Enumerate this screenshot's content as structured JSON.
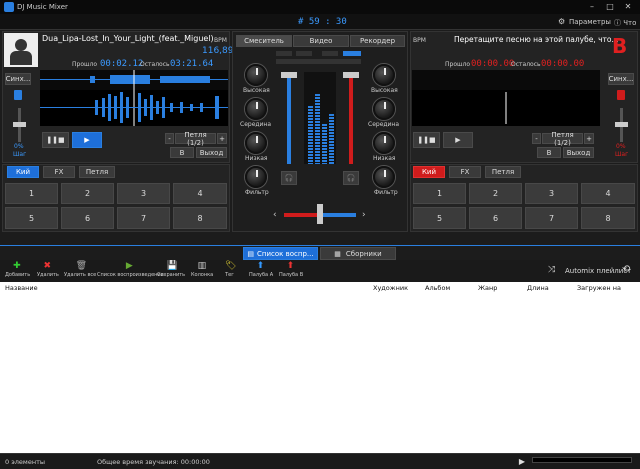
{
  "window": {
    "title": "DJ Music Mixer",
    "clock": "# 59 : 30",
    "params_label": "Параметры"
  },
  "deck_a": {
    "track_title": "Dua_Lipa-Lost_In_Your_Light_(feat._Miguel)",
    "bpm_label": "BPM",
    "bpm": "116,89",
    "elapsed_label": "Прошло",
    "elapsed": "00:02.12",
    "remaining_label": "Осталось",
    "remaining": "03:21.64",
    "sync_label": "Синх...",
    "pitch_pct": "0%",
    "step_label": "Шаг",
    "minus": "-",
    "plus": "+",
    "loop_label": "Петля (1/2)",
    "b_label": "B",
    "exit_label": "Выход",
    "tabs": [
      "Кий",
      "FX",
      "Петля"
    ],
    "pads": [
      "1",
      "2",
      "3",
      "4",
      "5",
      "6",
      "7",
      "8"
    ]
  },
  "deck_b": {
    "letter": "B",
    "bpm_label": "BPM",
    "drop_hint": "Перетащите песню на этой палубе, что...",
    "elapsed_label": "Прошло",
    "elapsed": "00:00.00",
    "remaining_label": "Осталось",
    "remaining": "00:00.00",
    "sync_label": "Синх...",
    "pitch_pct": "0%",
    "step_label": "Шаг",
    "minus": "-",
    "plus": "+",
    "loop_label": "Петля (1/2)",
    "b_label": "B",
    "exit_label": "Выход",
    "tabs": [
      "Кий",
      "FX",
      "Петля"
    ],
    "pads": [
      "1",
      "2",
      "3",
      "4",
      "5",
      "6",
      "7",
      "8"
    ]
  },
  "mixer": {
    "tabs": [
      "Смеситель",
      "Видео",
      "Рекордер"
    ],
    "knobs": [
      "Высокая",
      "Середина",
      "Низкая",
      "Фильтр"
    ]
  },
  "library": {
    "tabs": [
      "Список воспр...",
      "Сборники"
    ],
    "toolbar": [
      "Добавить",
      "Удалить",
      "Удалить все",
      "Список воспроизведения",
      "Сохранить",
      "Колонка",
      "Тег",
      "Палуба A",
      "Палуба B"
    ],
    "automix_label": "Automix плейлист",
    "columns": [
      "Название",
      "Художник",
      "Альбом",
      "Жанр",
      "Длина",
      "Загружен на"
    ]
  },
  "status": {
    "count": "0 элементы",
    "total": "Общее время звучания: 00:00:00"
  },
  "colors": {
    "accent_blue": "#1e6fd9",
    "accent_red": "#d01c1c"
  }
}
